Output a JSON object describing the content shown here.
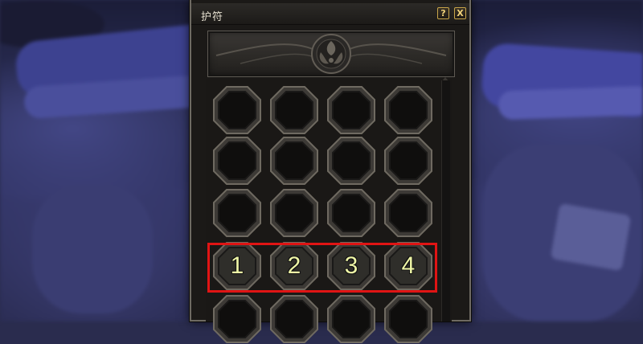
{
  "window": {
    "title": "护符",
    "help_label": "?",
    "close_label": "X"
  },
  "slots": {
    "rows": [
      [
        {
          "label": ""
        },
        {
          "label": ""
        },
        {
          "label": ""
        },
        {
          "label": ""
        }
      ],
      [
        {
          "label": ""
        },
        {
          "label": ""
        },
        {
          "label": ""
        },
        {
          "label": ""
        }
      ],
      [
        {
          "label": ""
        },
        {
          "label": ""
        },
        {
          "label": ""
        },
        {
          "label": ""
        }
      ],
      [
        {
          "label": "1"
        },
        {
          "label": "2"
        },
        {
          "label": "3"
        },
        {
          "label": "4"
        }
      ],
      [
        {
          "label": ""
        },
        {
          "label": ""
        },
        {
          "label": ""
        },
        {
          "label": ""
        }
      ]
    ]
  },
  "colors": {
    "highlight": "#e01414",
    "label_text": "#eef5a6",
    "button_border": "#c9a64a"
  }
}
